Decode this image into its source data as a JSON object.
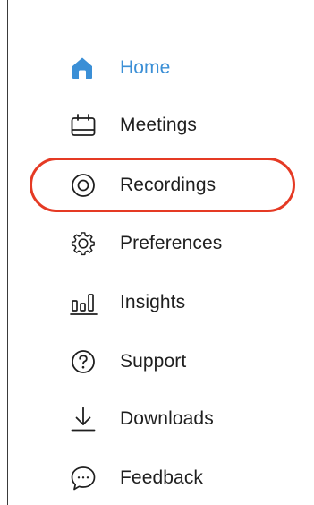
{
  "sidebar": {
    "items": [
      {
        "label": "Home",
        "icon": "home-icon",
        "active": true
      },
      {
        "label": "Meetings",
        "icon": "calendar-icon",
        "active": false
      },
      {
        "label": "Recordings",
        "icon": "recording-icon",
        "active": false
      },
      {
        "label": "Preferences",
        "icon": "gear-icon",
        "active": false
      },
      {
        "label": "Insights",
        "icon": "bar-chart-icon",
        "active": false
      },
      {
        "label": "Support",
        "icon": "question-icon",
        "active": false
      },
      {
        "label": "Downloads",
        "icon": "download-icon",
        "active": false
      },
      {
        "label": "Feedback",
        "icon": "chat-bubble-icon",
        "active": false
      }
    ],
    "active_color": "#3b8fd6",
    "highlight_color": "#e53a24"
  }
}
